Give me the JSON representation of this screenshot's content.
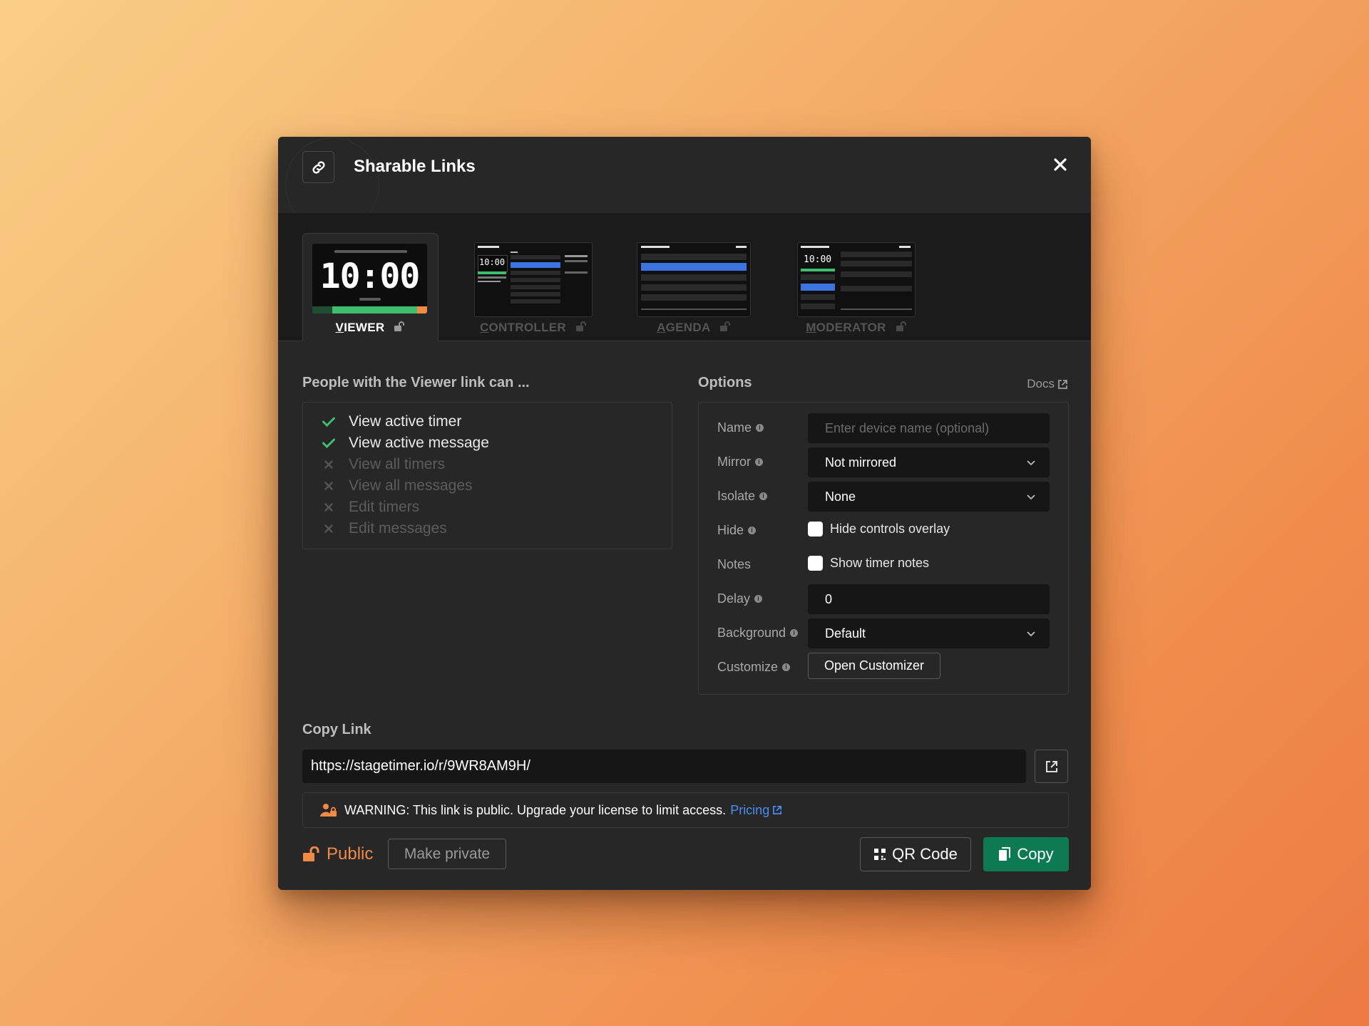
{
  "modal": {
    "title": "Sharable Links",
    "icon": "link-icon",
    "close_icon": "close-icon"
  },
  "tabs": [
    {
      "key": "viewer",
      "label_first": "V",
      "label_rest": "IEWER",
      "active": true,
      "thumb_time": "10:00"
    },
    {
      "key": "controller",
      "label_first": "C",
      "label_rest": "ONTROLLER",
      "active": false,
      "thumb_time": "10:00"
    },
    {
      "key": "agenda",
      "label_first": "A",
      "label_rest": "GENDA",
      "active": false
    },
    {
      "key": "moderator",
      "label_first": "M",
      "label_rest": "ODERATOR",
      "active": false,
      "thumb_time": "10:00"
    }
  ],
  "permissions": {
    "heading": "People with the Viewer link can ...",
    "items": [
      {
        "label": "View active timer",
        "allowed": true
      },
      {
        "label": "View active message",
        "allowed": true
      },
      {
        "label": "View all timers",
        "allowed": false
      },
      {
        "label": "View all messages",
        "allowed": false
      },
      {
        "label": "Edit timers",
        "allowed": false
      },
      {
        "label": "Edit messages",
        "allowed": false
      }
    ]
  },
  "options": {
    "heading": "Options",
    "docs_label": "Docs",
    "name": {
      "label": "Name",
      "placeholder": "Enter device name (optional)",
      "value": ""
    },
    "mirror": {
      "label": "Mirror",
      "value": "Not mirrored"
    },
    "isolate": {
      "label": "Isolate",
      "value": "None"
    },
    "hide": {
      "label": "Hide",
      "checkbox_label": "Hide controls overlay",
      "checked": false
    },
    "notes": {
      "label": "Notes",
      "checkbox_label": "Show timer notes",
      "checked": false
    },
    "delay": {
      "label": "Delay",
      "value": "0"
    },
    "background": {
      "label": "Background",
      "value": "Default"
    },
    "customize": {
      "label": "Customize",
      "button_label": "Open Customizer"
    }
  },
  "copy_link": {
    "heading": "Copy Link",
    "url": "https://stagetimer.io/r/9WR8AM9H/",
    "warning": "WARNING: This link is public. Upgrade your license to limit access.",
    "pricing_label": "Pricing"
  },
  "footer": {
    "visibility_label": "Public",
    "make_private_label": "Make private",
    "qr_label": "QR Code",
    "copy_label": "Copy"
  },
  "colors": {
    "accent_green": "#0d7a53",
    "check_green": "#3fbf6b",
    "public_orange": "#f08a45",
    "link_blue": "#4a8cf2"
  }
}
